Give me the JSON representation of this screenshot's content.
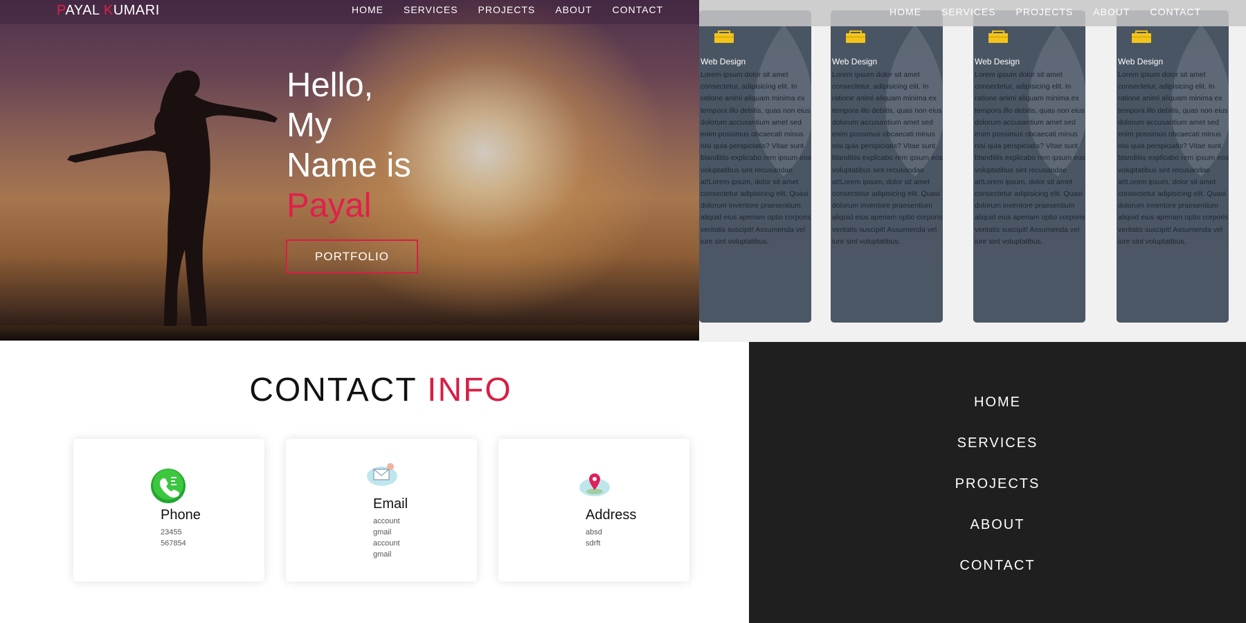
{
  "hero": {
    "brand_first_initial": "P",
    "brand_first_rest": "AYAL ",
    "brand_last_initial": "K",
    "brand_last_rest": "UMARI",
    "nav": [
      "HOME",
      "SERVICES",
      "PROJECTS",
      "ABOUT",
      "CONTACT"
    ],
    "greeting_lines": [
      "Hello,",
      "My",
      "Name is"
    ],
    "name": "Payal",
    "cta_label": "PORTFOLIO",
    "accent_color": "#e0204a"
  },
  "services": {
    "nav": [
      "HOME",
      "SERVICES",
      "PROJECTS",
      "ABOUT",
      "CONTACT"
    ],
    "cards": [
      {
        "icon": "briefcase-icon",
        "title": "Web Design",
        "body": "Lorem ipsum dolor sit amet consectetur, adipisicing elit. In ratione animi aliquam minima ex tempora illo debitis, quas non eius dolorum accusantium amet sed enim possimus obcaecati minus nisi quia perspiciatis? Vitae sunt blanditiis explicabo rem ipsum eos voluptatibus sint recusandae at!Lorem ipsum, dolor sit amet consectetur adipisicing elit. Quasi dolorum inventore praesentium aliquid eius aperiam optio corporis veritatis suscipit! Assumenda vel iure sint voluptatibus."
      },
      {
        "icon": "briefcase-icon",
        "title": "Web Design",
        "body": "Lorem ipsum dolor sit amet consectetur, adipisicing elit. In ratione animi aliquam minima ex tempora illo debitis, quas non eius dolorum accusantium amet sed enim possimus obcaecati minus nisi quia perspiciatis? Vitae sunt blanditiis explicabo rem ipsum eos voluptatibus sint recusandae at!Lorem ipsum, dolor sit amet consectetur adipisicing elit. Quasi dolorum inventore praesentium aliquid eius aperiam optio corporis veritatis suscipit! Assumenda vel iure sint voluptatibus."
      },
      {
        "icon": "briefcase-icon",
        "title": "Web Design",
        "body": "Lorem ipsum dolor sit amet consectetur, adipisicing elit. In ratione animi aliquam minima ex tempora illo debitis, quas non eius dolorum accusantium amet sed enim possimus obcaecati minus nisi quia perspiciatis? Vitae sunt blanditiis explicabo rem ipsum eos voluptatibus sint recusandae at!Lorem ipsum, dolor sit amet consectetur adipisicing elit. Quasi dolorum inventore praesentium aliquid eius aperiam optio corporis veritatis suscipit! Assumenda vel iure sint voluptatibus."
      },
      {
        "icon": "briefcase-icon",
        "title": "Web Design",
        "body": "Lorem ipsum dolor sit amet consectetur, adipisicing elit. In ratione animi aliquam minima ex tempora illo debitis, quas non eius dolorum accusantium amet sed enim possimus obcaecati minus nisi quia perspiciatis? Vitae sunt blanditiis explicabo rem ipsum eos voluptatibus sint recusandae at!Lorem ipsum, dolor sit amet consectetur adipisicing elit. Quasi dolorum inventore praesentium aliquid eius aperiam optio corporis veritatis suscipit! Assumenda vel iure sint voluptatibus."
      }
    ],
    "card_icon_color": "#f4c41a"
  },
  "contact": {
    "title_main": "CONTACT ",
    "title_accent": "INFO",
    "cards": [
      {
        "icon": "phone-icon",
        "label": "Phone",
        "lines": [
          "23455",
          "567854"
        ]
      },
      {
        "icon": "email-icon",
        "label": "Email",
        "lines": [
          "account",
          "gmail",
          "account",
          "gmail"
        ]
      },
      {
        "icon": "map-pin-icon",
        "label": "Address",
        "lines": [
          "absd",
          "sdrft"
        ]
      }
    ]
  },
  "mobile_menu": {
    "items": [
      "HOME",
      "SERVICES",
      "PROJECTS",
      "ABOUT",
      "CONTACT"
    ]
  }
}
